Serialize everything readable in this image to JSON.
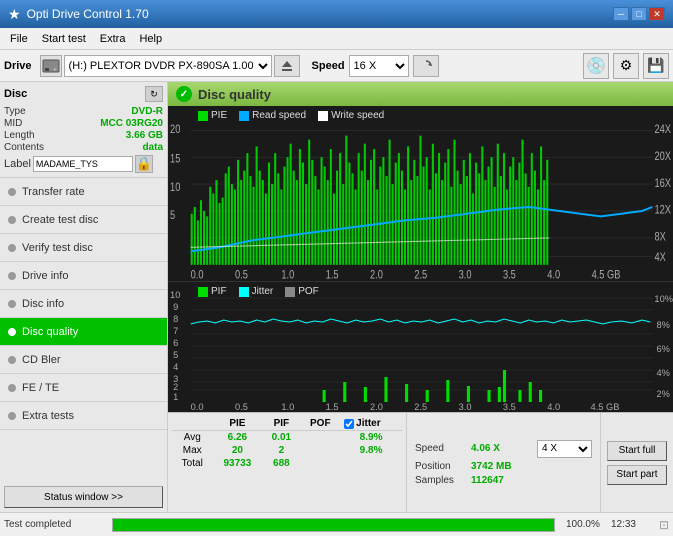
{
  "titlebar": {
    "title": "Opti Drive Control 1.70",
    "icon": "★",
    "min": "─",
    "max": "□",
    "close": "✕"
  },
  "menubar": {
    "items": [
      "File",
      "Start test",
      "Extra",
      "Help"
    ]
  },
  "drive": {
    "label": "Drive",
    "icon_label": "H:",
    "select_value": "(H:)  PLEXTOR DVDR   PX-890SA 1.00",
    "speed_label": "Speed",
    "speed_value": "16 X"
  },
  "disc": {
    "title": "Disc",
    "type_key": "Type",
    "type_val": "DVD-R",
    "mid_key": "MID",
    "mid_val": "MCC 03RG20",
    "length_key": "Length",
    "length_val": "3.66 GB",
    "contents_key": "Contents",
    "contents_val": "data",
    "label_key": "Label",
    "label_val": "MADAME_TYS"
  },
  "nav": {
    "items": [
      {
        "id": "transfer-rate",
        "label": "Transfer rate",
        "active": false
      },
      {
        "id": "create-test-disc",
        "label": "Create test disc",
        "active": false
      },
      {
        "id": "verify-test-disc",
        "label": "Verify test disc",
        "active": false
      },
      {
        "id": "drive-info",
        "label": "Drive info",
        "active": false
      },
      {
        "id": "disc-info",
        "label": "Disc info",
        "active": false
      },
      {
        "id": "disc-quality",
        "label": "Disc quality",
        "active": true
      },
      {
        "id": "cd-bler",
        "label": "CD Bler",
        "active": false
      },
      {
        "id": "fe-te",
        "label": "FE / TE",
        "active": false
      },
      {
        "id": "extra-tests",
        "label": "Extra tests",
        "active": false
      }
    ]
  },
  "sidebar_btn": "Status window >>",
  "content": {
    "title": "Disc quality",
    "legend1_color": "#00dd00",
    "legend1_label": "PIE",
    "legend2_color": "#00aaff",
    "legend2_label": "Read speed",
    "legend3_color": "#ffffff",
    "legend3_label": "Write speed",
    "pif_legend1_color": "#00dd00",
    "pif_legend1_label": "PIF",
    "pif_legend2_color": "#00ffff",
    "pif_legend2_label": "Jitter",
    "pif_legend3_color": "#888888",
    "pif_legend3_label": "POF"
  },
  "stats": {
    "headers": [
      "PIE",
      "PIF",
      "POF",
      "Jitter"
    ],
    "avg_label": "Avg",
    "avg_pie": "6.26",
    "avg_pif": "0.01",
    "avg_pof": "",
    "avg_jitter": "8.9%",
    "max_label": "Max",
    "max_pie": "20",
    "max_pif": "2",
    "max_pof": "",
    "max_jitter": "9.8%",
    "total_label": "Total",
    "total_pie": "93733",
    "total_pif": "688",
    "total_pof": "",
    "jitter_checked": true,
    "speed_key": "Speed",
    "speed_val": "4.06 X",
    "position_key": "Position",
    "position_val": "3742 MB",
    "samples_key": "Samples",
    "samples_val": "112647",
    "speed_dropdown": "4 X",
    "btn_full": "Start full",
    "btn_part": "Start part"
  },
  "statusbar": {
    "text": "Test completed",
    "progress_pct": 100,
    "progress_label": "100.0%",
    "time": "12:33"
  }
}
